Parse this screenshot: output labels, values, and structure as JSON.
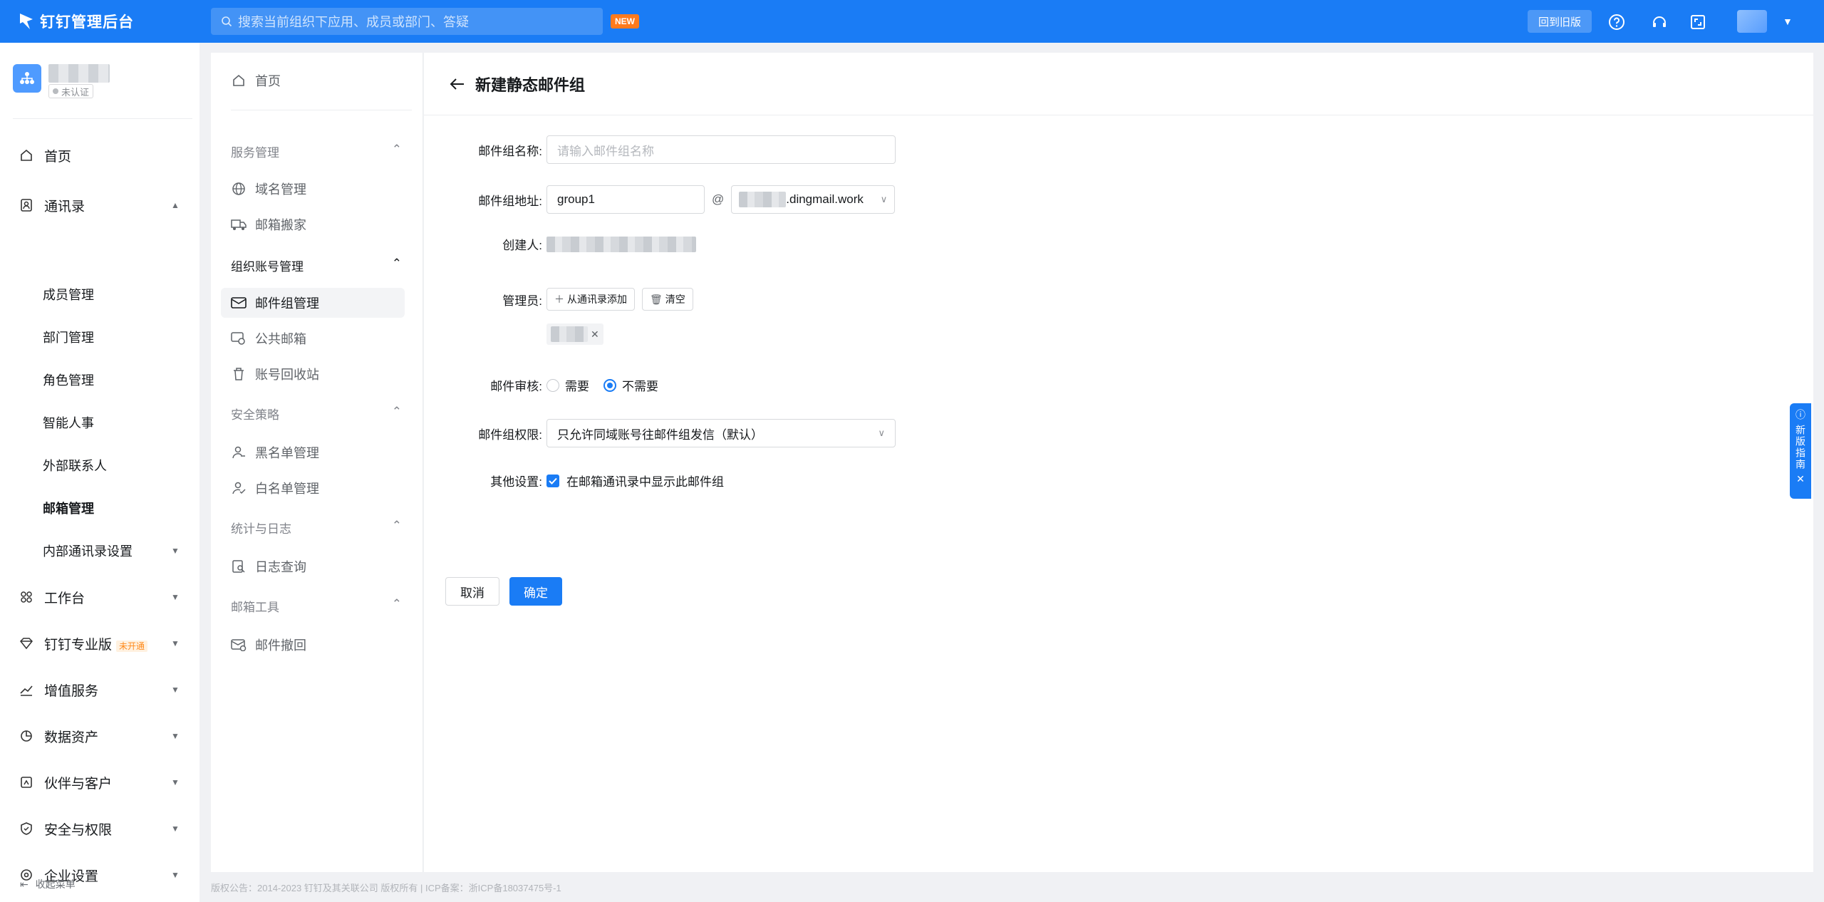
{
  "topbar": {
    "app_title": "钉钉管理后台",
    "search_placeholder": "搜索当前组织下应用、成员或部门、答疑",
    "new_badge": "NEW",
    "old_version_button": "回到旧版"
  },
  "org": {
    "status": "未认证"
  },
  "sidebar": {
    "items": [
      {
        "label": "首页",
        "icon": "home-icon"
      },
      {
        "label": "通讯录",
        "icon": "contacts-icon"
      },
      {
        "label": "成员管理"
      },
      {
        "label": "部门管理"
      },
      {
        "label": "角色管理"
      },
      {
        "label": "智能人事"
      },
      {
        "label": "外部联系人"
      },
      {
        "label": "邮箱管理"
      },
      {
        "label": "内部通讯录设置"
      },
      {
        "label": "工作台",
        "icon": "apps-icon"
      },
      {
        "label": "钉钉专业版",
        "icon": "diamond-icon",
        "badge": "未开通"
      },
      {
        "label": "增值服务",
        "icon": "trend-icon"
      },
      {
        "label": "数据资产",
        "icon": "pie-icon"
      },
      {
        "label": "伙伴与客户",
        "icon": "partner-icon"
      },
      {
        "label": "安全与权限",
        "icon": "shield-icon"
      },
      {
        "label": "企业设置",
        "icon": "settings-icon"
      }
    ],
    "collapse_label": "收起菜单"
  },
  "subnav": {
    "home": "首页",
    "groups": [
      {
        "title": "服务管理",
        "items": [
          "域名管理",
          "邮箱搬家"
        ]
      },
      {
        "title": "组织账号管理",
        "items": [
          "邮件组管理",
          "公共邮箱",
          "账号回收站"
        ]
      },
      {
        "title": "安全策略",
        "items": [
          "黑名单管理",
          "白名单管理"
        ]
      },
      {
        "title": "统计与日志",
        "items": [
          "日志查询"
        ]
      },
      {
        "title": "邮箱工具",
        "items": [
          "邮件撤回"
        ]
      }
    ],
    "active": "邮件组管理"
  },
  "form": {
    "page_title": "新建静态邮件组",
    "name_label": "邮件组名称:",
    "name_placeholder": "请输入邮件组名称",
    "address_label": "邮件组地址:",
    "address_value": "group1",
    "at_sign": "@",
    "domain_suffix": ".dingmail.work",
    "creator_label": "创建人:",
    "admin_label": "管理员:",
    "add_from_contacts": "从通讯录添加",
    "clear_button": "清空",
    "review_label": "邮件审核:",
    "review_options": [
      "需要",
      "不需要"
    ],
    "review_selected": "不需要",
    "permission_label": "邮件组权限:",
    "permission_value": "只允许同域账号往邮件组发信（默认）",
    "other_label": "其他设置:",
    "other_checkbox": "在邮箱通讯录中显示此邮件组",
    "other_checked": true,
    "cancel_button": "取消",
    "confirm_button": "确定"
  },
  "guide": {
    "label": "新版指南"
  },
  "footer": {
    "text": "版权公告：2014-2023 钉钉及其关联公司 版权所有 | ICP备案：浙ICP备18037475号-1"
  }
}
